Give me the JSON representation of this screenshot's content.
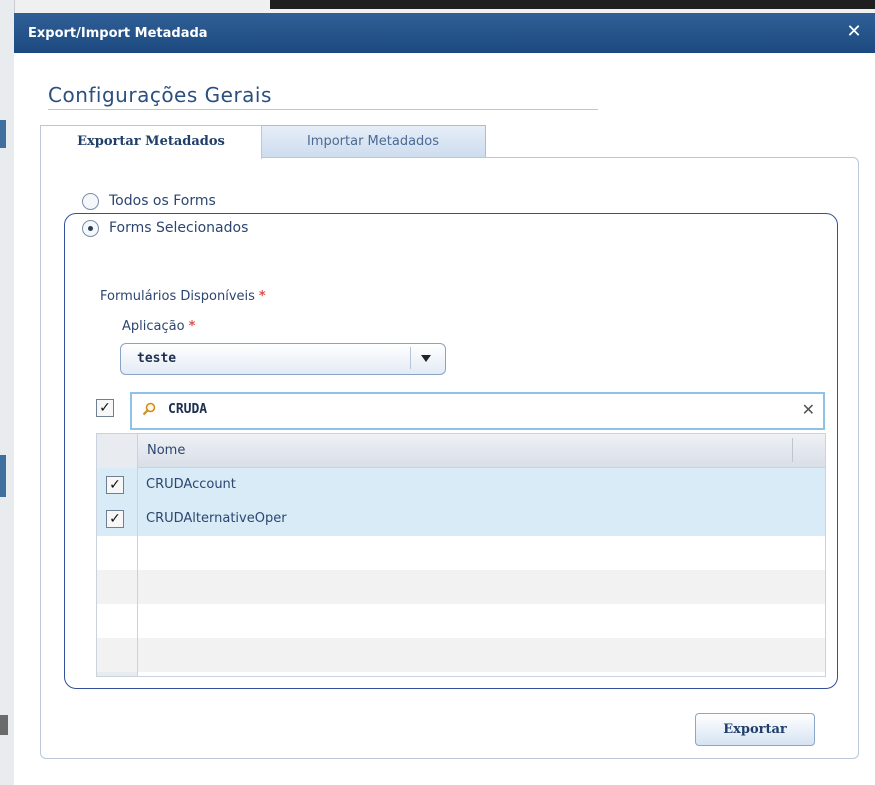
{
  "dialog": {
    "title": "Export/Import Metadada",
    "close_glyph": "✕"
  },
  "section_title": "Configurações Gerais",
  "tabs": [
    {
      "label": "Exportar Metadados",
      "active": true
    },
    {
      "label": "Importar Metadados",
      "active": false
    }
  ],
  "radios": [
    {
      "label": "Todos os Forms",
      "checked": false
    },
    {
      "label": "Forms Selecionados",
      "checked": true
    }
  ],
  "forms_label": "Formulários Disponíveis",
  "application": {
    "label": "Aplicação",
    "selected": "teste"
  },
  "required_mark": "*",
  "search": {
    "value": "CRUDA",
    "select_all_checked": true,
    "clear_glyph": "✕"
  },
  "grid": {
    "column": "Nome",
    "rows": [
      {
        "name": "CRUDAccount",
        "checked": true
      },
      {
        "name": "CRUDAlternativeOper",
        "checked": true
      }
    ]
  },
  "export_button": "Exportar",
  "icons": [
    "close-icon",
    "search-icon",
    "dropdown-arrow-icon",
    "clear-icon",
    "checkbox-icon"
  ],
  "colors": {
    "titlebar": "#1c4a80",
    "accent_text": "#2b4f7e",
    "required": "#e0504a",
    "row_selected": "#d8ebf6",
    "group_border": "#34509a"
  }
}
